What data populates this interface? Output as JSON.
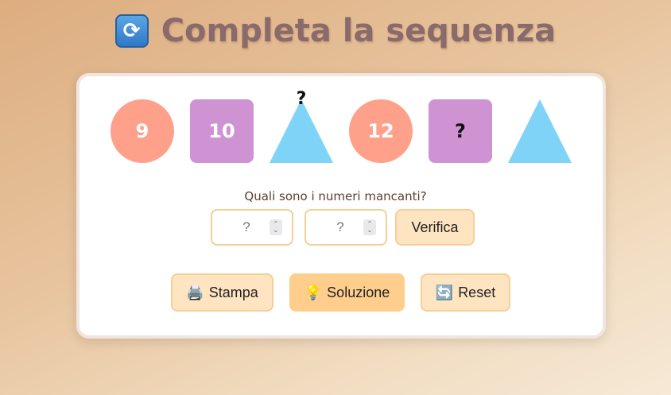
{
  "title": {
    "icon": "repeat-arrows-icon",
    "text": "Completa la sequenza"
  },
  "sequence": [
    {
      "shape": "circle",
      "label": "9",
      "color": "#ffa08a"
    },
    {
      "shape": "square",
      "label": "10",
      "color": "#cf93d4"
    },
    {
      "shape": "triangle",
      "label": "?",
      "color": "#7fd3f7"
    },
    {
      "shape": "circle",
      "label": "12",
      "color": "#ffa08a"
    },
    {
      "shape": "square",
      "label": "?",
      "color": "#cf93d4"
    },
    {
      "shape": "triangle",
      "label": "",
      "color": "#7fd3f7"
    }
  ],
  "prompt": "Quali sono i numeri mancanti?",
  "inputs": [
    {
      "placeholder": "?",
      "value": ""
    },
    {
      "placeholder": "?",
      "value": ""
    }
  ],
  "buttons": {
    "verify": "Verifica",
    "print": "Stampa",
    "print_icon": "printer-icon",
    "solution": "Soluzione",
    "solution_icon": "lightbulb-icon",
    "reset": "Reset",
    "reset_icon": "refresh-icon"
  },
  "colors": {
    "circle": "#ffa08a",
    "square": "#cf93d4",
    "triangle": "#7fd3f7",
    "accent": "#ffcd8c",
    "button_bg": "#ffe4c2",
    "title": "#8a6a6a"
  }
}
